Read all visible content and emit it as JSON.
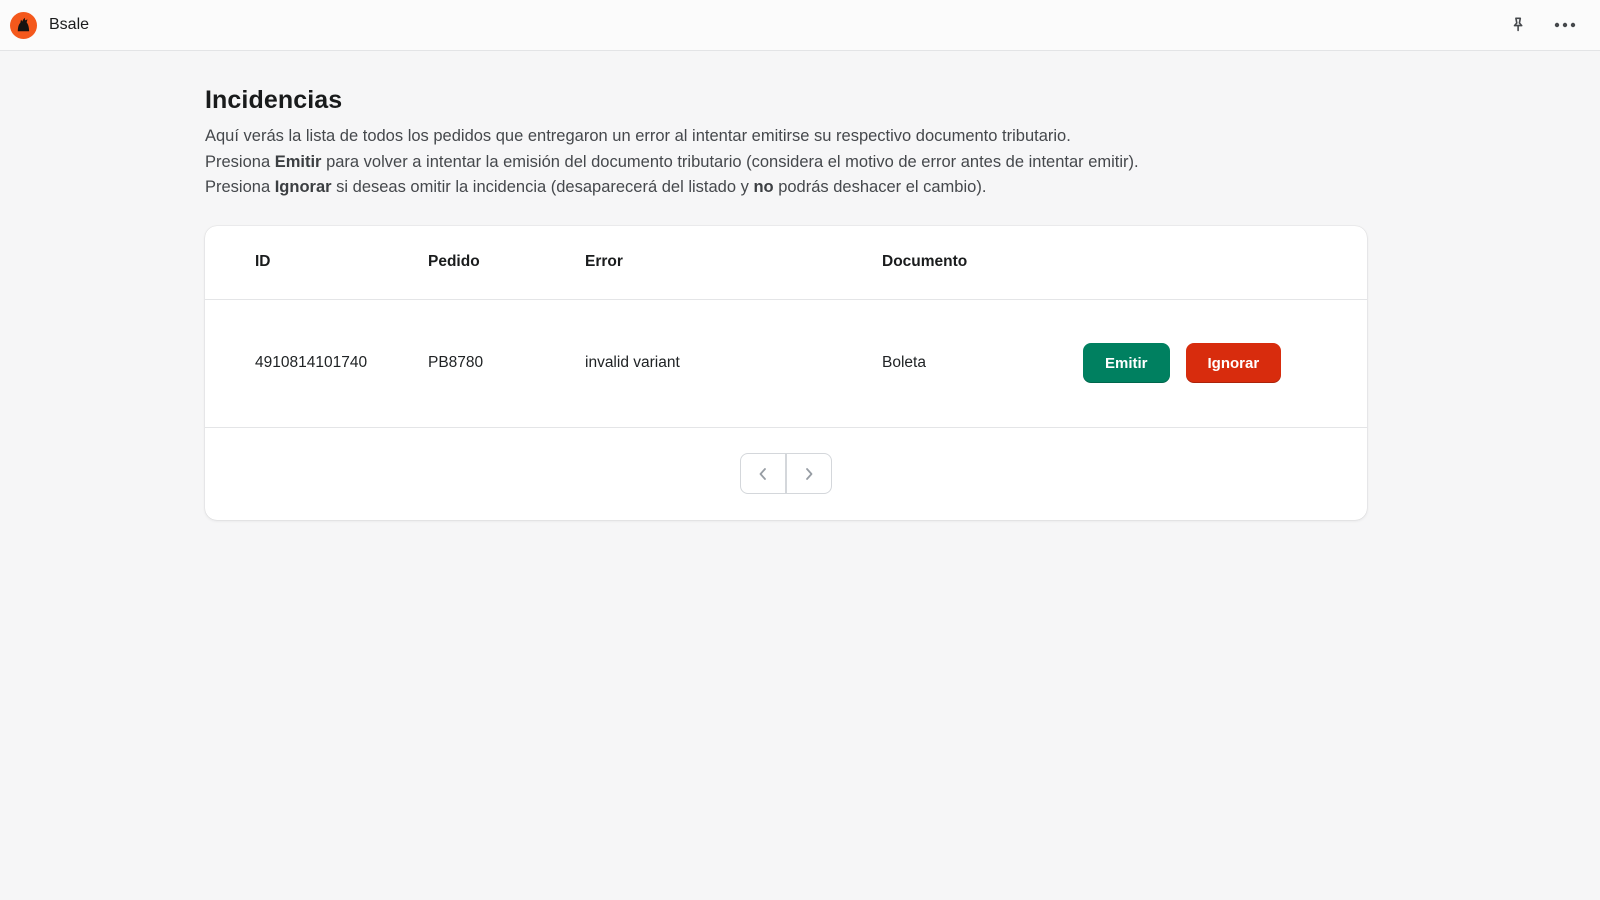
{
  "colors": {
    "emit_green": "#008060",
    "ignore_red": "#d82c0d",
    "brand_orange": "#f4581c"
  },
  "topbar": {
    "app_name": "Bsale"
  },
  "page": {
    "title": "Incidencias",
    "intro": {
      "line1": "Aquí verás la lista de todos los pedidos que entregaron un error al intentar emitirse su respectivo documento tributario.",
      "line2": {
        "pre": "Presiona ",
        "bold": "Emitir",
        "post": " para volver a intentar la emisión del documento tributario (considera el motivo de error antes de intentar emitir)."
      },
      "line3": {
        "pre": "Presiona ",
        "bold": "Ignorar",
        "mid": " si deseas omitir la incidencia (desaparecerá del listado y ",
        "bold2": "no",
        "post": " podrás deshacer el cambio)."
      }
    }
  },
  "table": {
    "headers": [
      "ID",
      "Pedido",
      "Error",
      "Documento"
    ],
    "rows": [
      {
        "id": "4910814101740",
        "pedido": "PB8780",
        "error": "invalid variant",
        "documento": "Boleta",
        "emit_label": "Emitir",
        "ignore_label": "Ignorar"
      }
    ]
  }
}
